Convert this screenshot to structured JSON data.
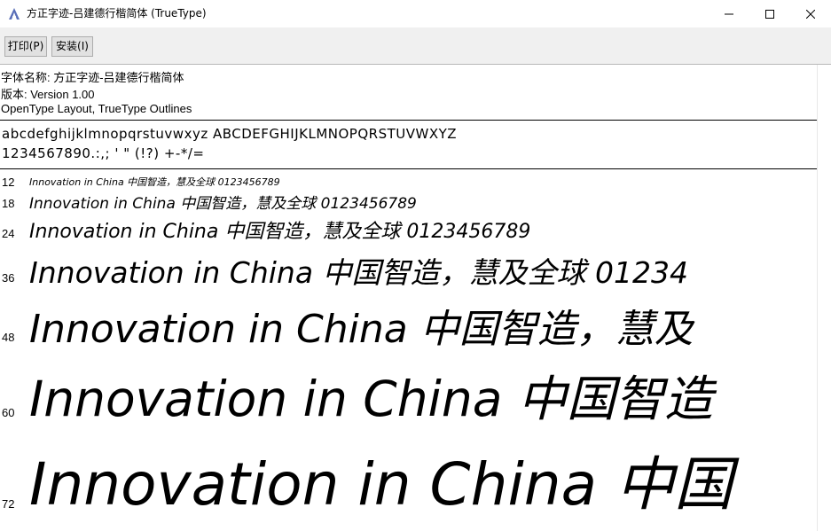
{
  "window": {
    "title": "方正字迹-吕建德行楷简体 (TrueType)"
  },
  "toolbar": {
    "print_label": "打印(P)",
    "install_label": "安装(I)"
  },
  "font_info": {
    "name_line": "字体名称: 方正字迹-吕建德行楷简体",
    "version_line": "版本: Version 1.00",
    "format_line": "OpenType Layout, TrueType Outlines"
  },
  "charset": {
    "line1": "abcdefghijklmnopqrstuvwxyz ABCDEFGHIJKLMNOPQRSTUVWXYZ",
    "line2": "1234567890.:,; ' \" (!?) +-*/="
  },
  "samples": [
    {
      "size": "12",
      "text": "Innovation in China 中国智造，慧及全球 0123456789"
    },
    {
      "size": "18",
      "text": "Innovation in China 中国智造，慧及全球 0123456789"
    },
    {
      "size": "24",
      "text": "Innovation in China 中国智造，慧及全球 0123456789"
    },
    {
      "size": "36",
      "text": "Innovation in China 中国智造，慧及全球 01234"
    },
    {
      "size": "48",
      "text": "Innovation in China 中国智造，慧及"
    },
    {
      "size": "60",
      "text": "Innovation in China 中国智造"
    },
    {
      "size": "72",
      "text": "Innovation in China 中国"
    }
  ]
}
